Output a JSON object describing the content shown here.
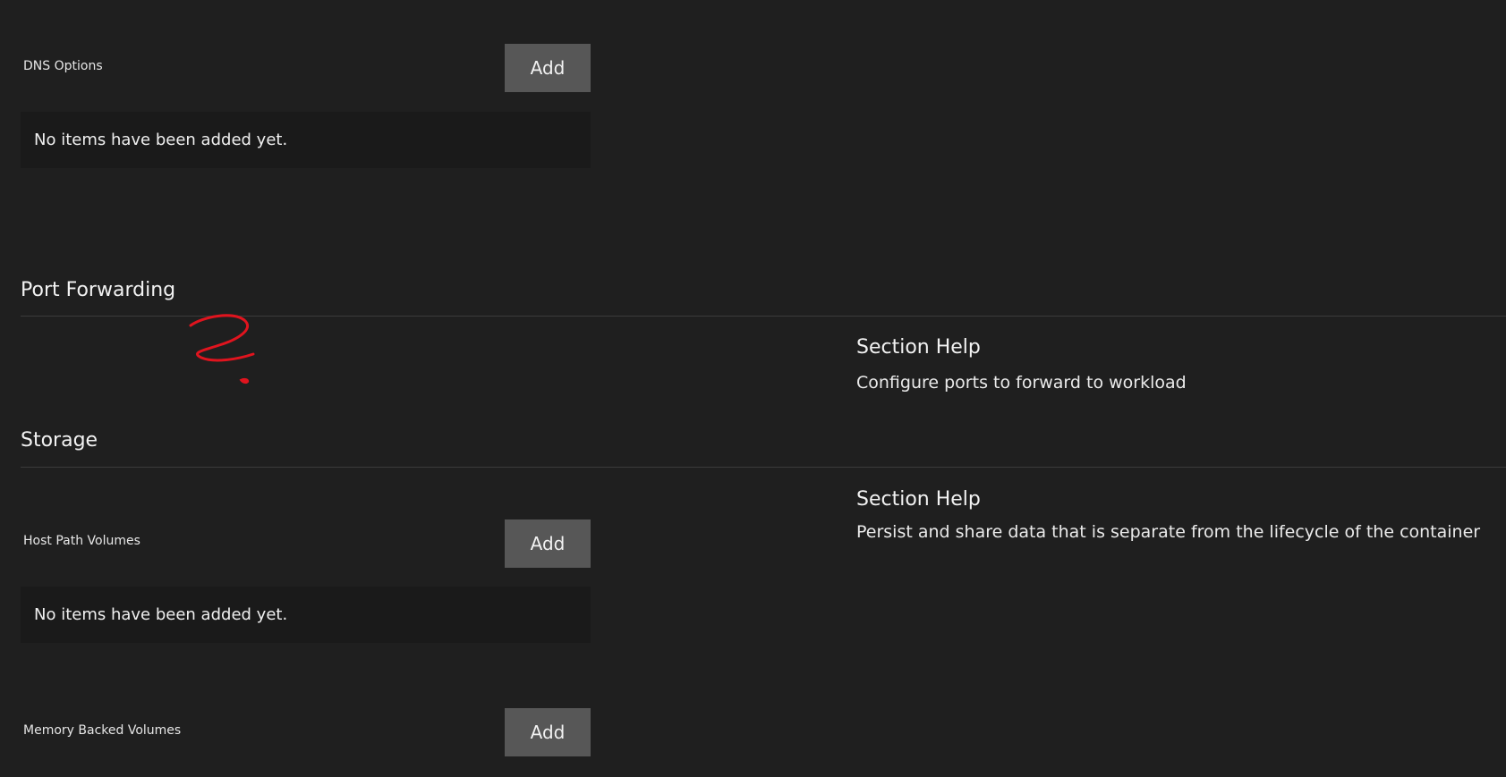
{
  "dns": {
    "label": "DNS Options",
    "add_label": "Add",
    "empty_text": "No items have been added yet."
  },
  "port_forwarding": {
    "title": "Port Forwarding",
    "help_title": "Section Help",
    "help_text": "Configure ports to forward to workload"
  },
  "storage": {
    "title": "Storage",
    "help_title": "Section Help",
    "help_text": "Persist and share data that is separate from the lifecycle of the container",
    "host_path": {
      "label": "Host Path Volumes",
      "add_label": "Add",
      "empty_text": "No items have been added yet."
    },
    "memory_backed": {
      "label": "Memory Backed Volumes",
      "add_label": "Add"
    }
  },
  "annotation": {
    "icon": "question-mark-scribble-icon",
    "color": "#e0141e"
  }
}
